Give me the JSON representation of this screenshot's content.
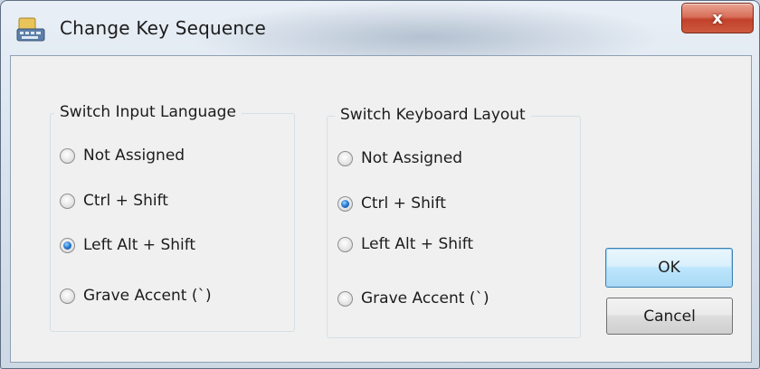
{
  "window": {
    "title": "Change Key Sequence",
    "close_label": "x"
  },
  "groups": {
    "input_language": {
      "label": "Switch Input Language",
      "options": [
        {
          "label": "Not Assigned",
          "checked": false
        },
        {
          "label": "Ctrl + Shift",
          "checked": false
        },
        {
          "label": "Left Alt + Shift",
          "checked": true
        },
        {
          "label": "Grave Accent (`)",
          "checked": false
        }
      ]
    },
    "keyboard_layout": {
      "label": "Switch Keyboard Layout",
      "options": [
        {
          "label": "Not Assigned",
          "checked": false
        },
        {
          "label": "Ctrl + Shift",
          "checked": true
        },
        {
          "label": "Left Alt + Shift",
          "checked": false
        },
        {
          "label": "Grave Accent (`)",
          "checked": false
        }
      ]
    }
  },
  "buttons": {
    "ok": "OK",
    "cancel": "Cancel"
  }
}
